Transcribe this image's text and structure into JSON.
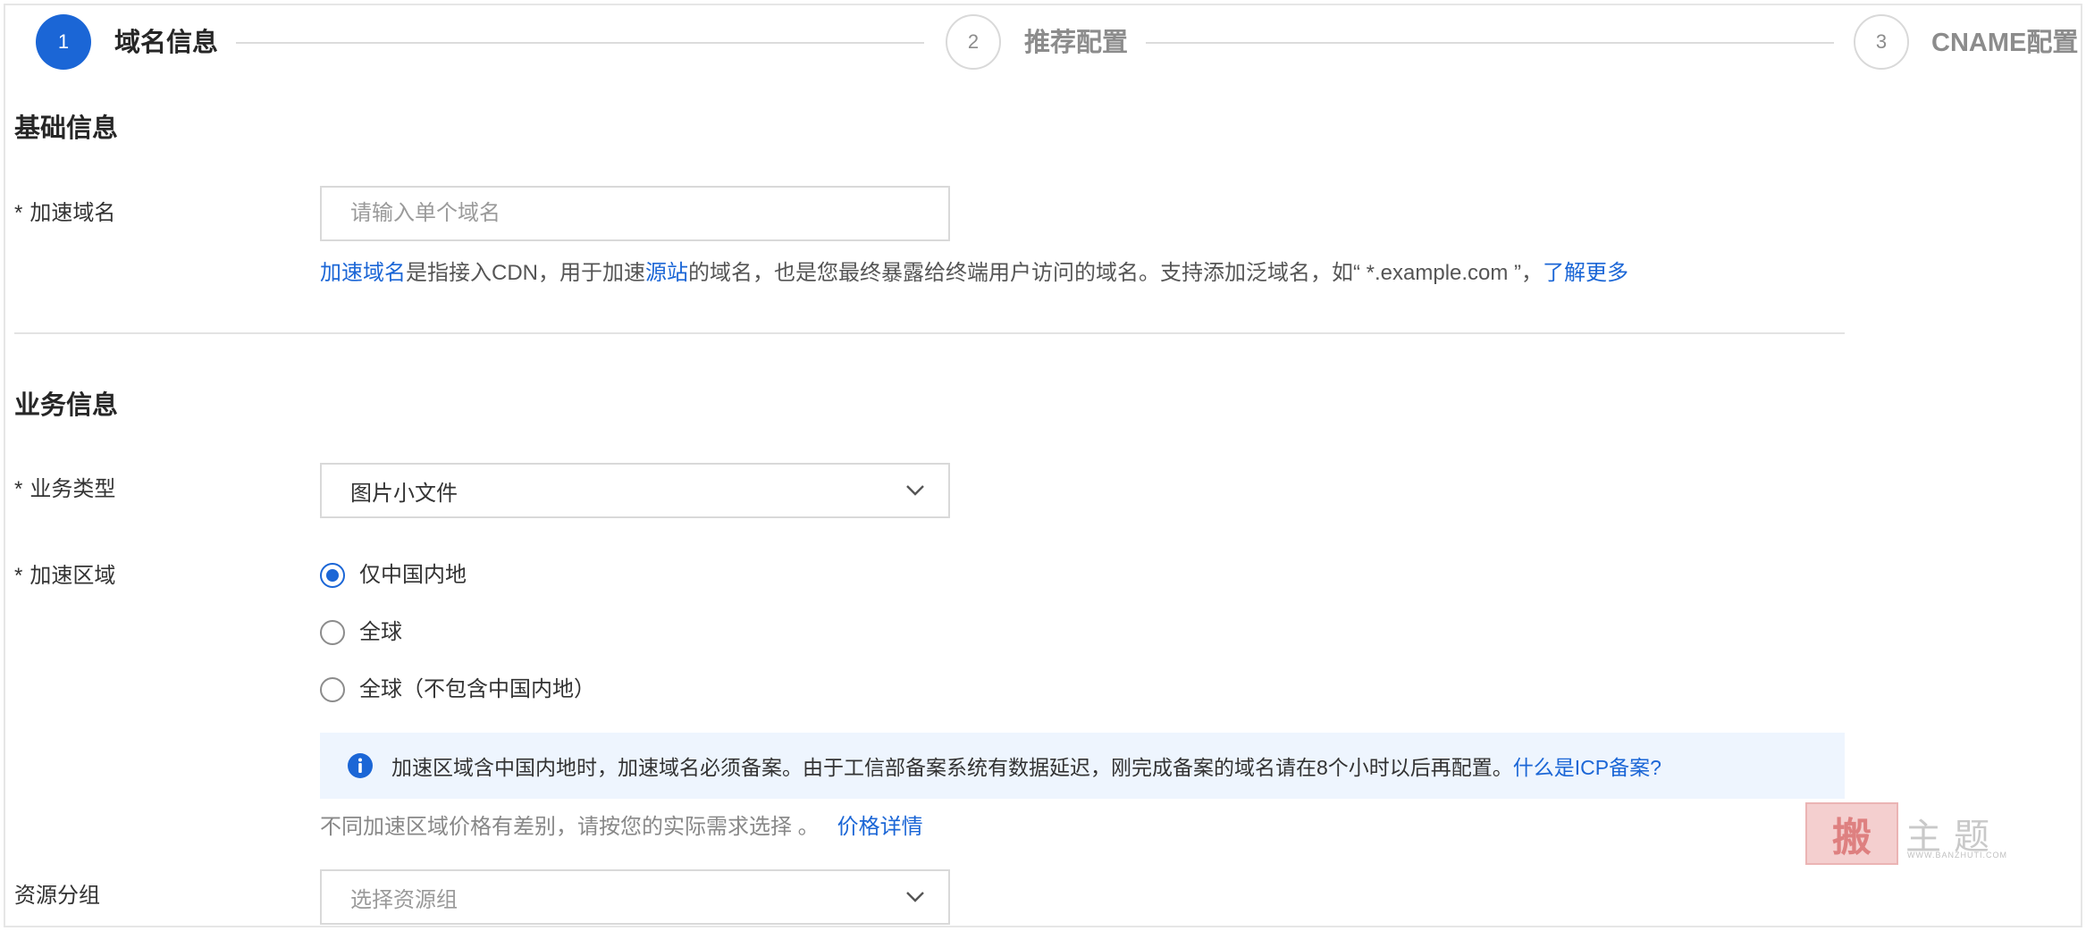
{
  "steps": [
    {
      "number": "1",
      "label": "域名信息",
      "state": "active"
    },
    {
      "number": "2",
      "label": "推荐配置",
      "state": "inactive"
    },
    {
      "number": "3",
      "label": "CNAME配置",
      "state": "inactive"
    }
  ],
  "basic": {
    "title": "基础信息",
    "domain_label": "加速域名",
    "domain_placeholder": "请输入单个域名",
    "help": {
      "link1": "加速域名",
      "part1": "是指接入CDN，用于加速",
      "link2": "源站",
      "part2": "的域名，也是您最终暴露给终端用户访问的域名。支持添加泛域名，如“ *.example.com ”，",
      "link3": "了解更多"
    }
  },
  "business": {
    "title": "业务信息",
    "type_label": "业务类型",
    "type_value": "图片小文件",
    "region_label": "加速区域",
    "regions": [
      {
        "label": "仅中国内地",
        "checked": true
      },
      {
        "label": "全球",
        "checked": false
      },
      {
        "label": "全球（不包含中国内地）",
        "checked": false
      }
    ],
    "notice_text": "加速区域含中国内地时，加速域名必须备案。由于工信部备案系统有数据延迟，刚完成备案的域名请在8个小时以后再配置。",
    "notice_link": "什么是ICP备案?",
    "price_text": "不同加速区域价格有差别，请按您的实际需求选择 。",
    "price_link": "价格详情",
    "resource_label": "资源分组",
    "resource_placeholder": "选择资源组"
  },
  "watermark": {
    "seal": "搬",
    "text": "主题",
    "url": "WWW.BANZHUTI.COM"
  },
  "colors": {
    "accent": "#1b66d6",
    "notice_bg": "#eef5fe"
  }
}
